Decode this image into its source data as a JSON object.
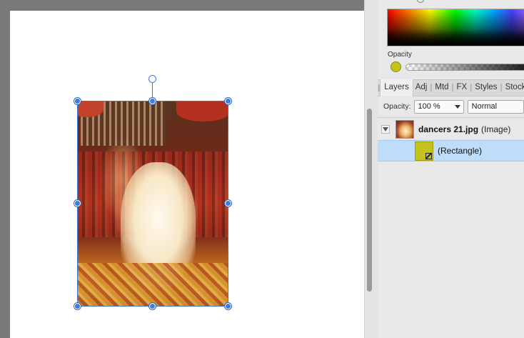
{
  "canvas": {
    "document": "white artboard",
    "selected_object": "photo"
  },
  "color_panel": {
    "opacity_label": "Opacity",
    "swatch_color": "#c5c21c"
  },
  "layers_panel": {
    "tabs": [
      "Layers",
      "Adj",
      "Mtd",
      "FX",
      "Styles",
      "Stock"
    ],
    "active_tab": "Layers",
    "opacity_label": "Opacity:",
    "opacity_value": "100 %",
    "blend_mode": "Normal",
    "layers": [
      {
        "name": "dancers 21.jpg",
        "type": "(Image)",
        "expanded": true
      },
      {
        "name": "(Rectangle)",
        "type": "",
        "selected": true,
        "color": "#c5c21c"
      }
    ]
  }
}
